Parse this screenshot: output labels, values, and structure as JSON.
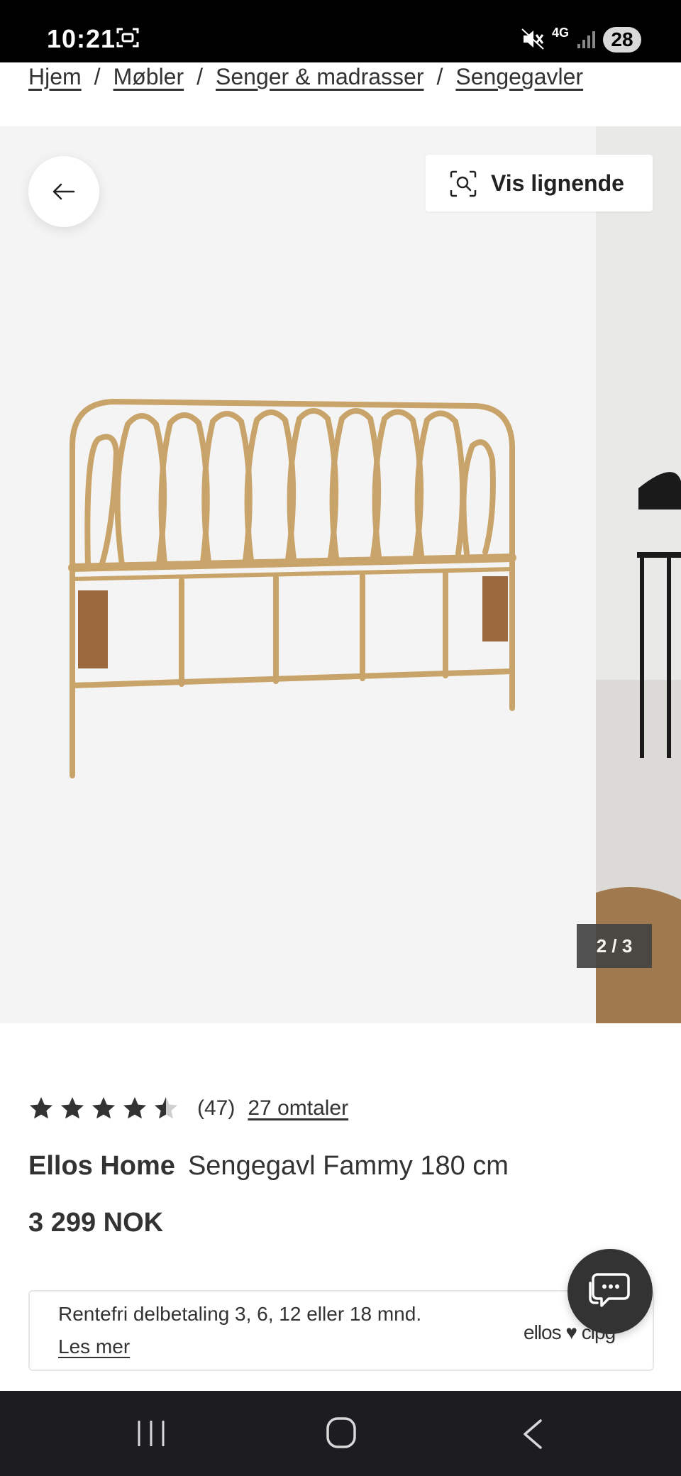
{
  "status_bar": {
    "time": "10:21",
    "network": "4G",
    "battery": "28"
  },
  "breadcrumb": [
    "Hjem",
    "Møbler",
    "Senger & madrasser",
    "Sengegavler"
  ],
  "gallery": {
    "similar_button": "Vis lignende",
    "counter": "2 / 3"
  },
  "product": {
    "rating_value": 4.5,
    "rating_count": "(47)",
    "reviews_link": "27 omtaler",
    "brand": "Ellos Home",
    "name": "Sengegavl Fammy 180 cm",
    "price": "3 299 NOK"
  },
  "payment": {
    "text": "Rentefri delbetaling 3, 6, 12 eller 18 mnd.",
    "link": "Les mer",
    "logo": "ellos ♥ cipg"
  },
  "icons": {
    "back": "arrow-left-icon",
    "similar": "visual-search-icon",
    "chat": "chat-bubble-icon",
    "star": "star-icon"
  },
  "colors": {
    "text": "#333333",
    "gallery_bg": "#f4f4f4",
    "rattan": "#c9a46a",
    "navbar": "#1c1c21"
  }
}
